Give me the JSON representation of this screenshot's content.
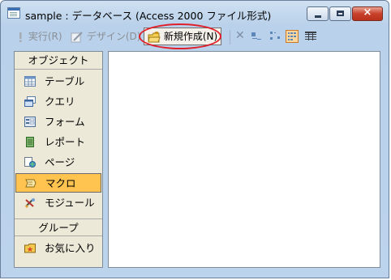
{
  "window": {
    "title": "sample : データベース (Access 2000 ファイル形式)",
    "caption_buttons": {
      "minimize": "minimize",
      "maximize": "maximize",
      "close": "×"
    }
  },
  "toolbar": {
    "run_label": "実行(R)",
    "design_label": "デザイン(D)",
    "new_label": "新規作成(N)",
    "delete_label": "✕"
  },
  "sidebar": {
    "objects_header": "オブジェクト",
    "items": [
      {
        "label": "テーブル",
        "icon": "table-icon"
      },
      {
        "label": "クエリ",
        "icon": "query-icon"
      },
      {
        "label": "フォーム",
        "icon": "form-icon"
      },
      {
        "label": "レポート",
        "icon": "report-icon"
      },
      {
        "label": "ページ",
        "icon": "page-icon"
      },
      {
        "label": "マクロ",
        "icon": "macro-icon",
        "selected": true
      },
      {
        "label": "モジュール",
        "icon": "module-icon"
      }
    ],
    "groups_header": "グループ",
    "favorites_label": "お気に入り"
  },
  "colors": {
    "selection": "#ffc34f",
    "highlight_ring": "#e0202a",
    "window_frame": "#b9d1ea"
  }
}
